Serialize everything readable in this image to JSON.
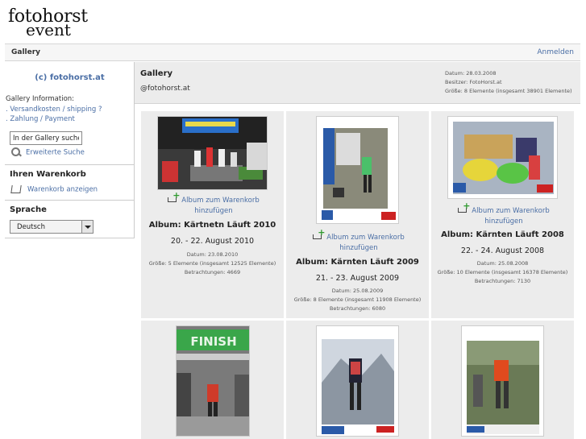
{
  "logo": {
    "line1": "fotohorst",
    "line2": "event"
  },
  "nav": {
    "gallery": "Gallery",
    "login": "Anmelden"
  },
  "sidebar": {
    "title": "(c) fotohorst.at",
    "info_header": "Gallery Information:",
    "link_shipping": ". Versandkosten / shipping ?",
    "link_payment": ". Zahlung / Payment",
    "search_value": "In der Gallery suchen",
    "advanced_search": "Erweiterte Suche",
    "cart_header": "Ihren Warenkorb",
    "cart_link": "Warenkorb anzeigen",
    "language_header": "Sprache",
    "language_value": "Deutsch"
  },
  "gallery": {
    "title": "Gallery",
    "subtitle": "@fotohorst.at",
    "meta_date": "Datum: 28.03.2008",
    "meta_owner": "Besitzer: FotoHorst.at",
    "meta_size": "Größe: 8 Elemente (insgesamt 38901 Elemente)"
  },
  "albums": [
    {
      "add_line1": "Album zum Warenkorb",
      "add_line2": "hinzufügen",
      "name": "Album: Kärtnetn Läuft 2010",
      "date_range": "20. - 22. August 2010",
      "date": "Datum: 23.08.2010",
      "size": "Größe: 5 Elemente (insgesamt 12525 Elemente)",
      "views": "Betrachtungen: 4669"
    },
    {
      "add_line1": "Album zum Warenkorb",
      "add_line2": "hinzufügen",
      "name": "Album: Kärnten Läuft 2009",
      "date_range": "21. - 23. August 2009",
      "date": "Datum: 25.08.2009",
      "size": "Größe: 8 Elemente (insgesamt 11908 Elemente)",
      "views": "Betrachtungen: 6080"
    },
    {
      "add_line1": "Album zum Warenkorb",
      "add_line2": "hinzufügen",
      "name": "Album: Kärnten Läuft 2008",
      "date_range": "22. - 24. August 2008",
      "date": "Datum: 25.08.2008",
      "size": "Größe: 10 Elemente (insgesamt 16378 Elemente)",
      "views": "Betrachtungen: 7130"
    }
  ],
  "thumb_texts": {
    "finish": "FINISH"
  }
}
